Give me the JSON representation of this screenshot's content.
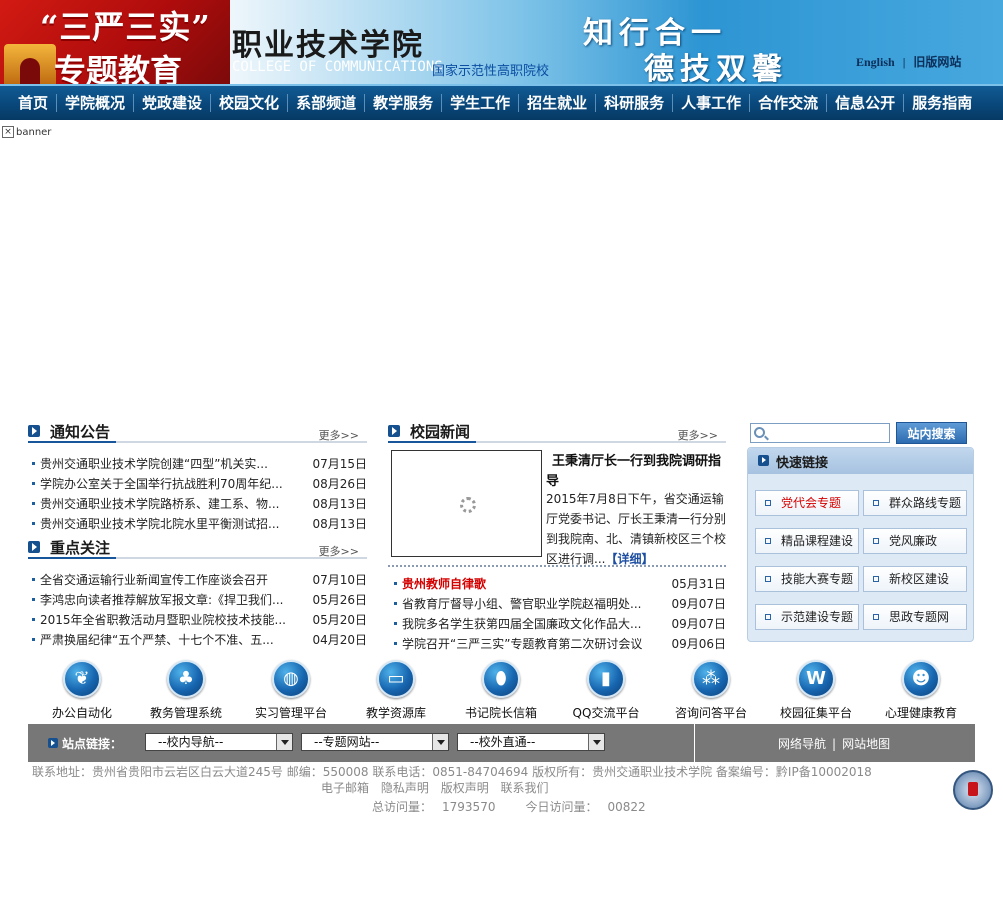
{
  "header": {
    "promo_line1": "“三严三实”",
    "promo_line2": "专题教育",
    "college_cn": "职业技术学院",
    "college_en": "COLLEGE OF COMMUNICATIONS",
    "college_tag": "国家示范性高职院校",
    "motto_line1": "知行合一",
    "motto_line2": "德技双馨",
    "lang_english": "English",
    "lang_sep": "|",
    "lang_old": "旧版网站"
  },
  "nav": {
    "items": [
      "首页",
      "学院概况",
      "党政建设",
      "校园文化",
      "系部频道",
      "教学服务",
      "学生工作",
      "招生就业",
      "科研服务",
      "人事工作",
      "合作交流",
      "信息公开",
      "服务指南"
    ]
  },
  "banner": {
    "alt": "banner"
  },
  "notice": {
    "title": "通知公告",
    "more": "更多>>",
    "items": [
      {
        "title": "贵州交通职业技术学院创建“四型”机关实...",
        "date": "07月15日"
      },
      {
        "title": "学院办公室关于全国举行抗战胜利70周年纪...",
        "date": "08月26日"
      },
      {
        "title": "贵州交通职业技术学院路桥系、建工系、物...",
        "date": "08月13日"
      },
      {
        "title": "贵州交通职业技术学院北院水里平衡测试招...",
        "date": "08月13日"
      }
    ]
  },
  "focus": {
    "title": "重点关注",
    "more": "更多>>",
    "items": [
      {
        "title": "全省交通运输行业新闻宣传工作座谈会召开",
        "date": "07月10日"
      },
      {
        "title": "李鸿忠向读者推荐解放军报文章:《捍卫我们...",
        "date": "05月26日"
      },
      {
        "title": "2015年全省职教活动月暨职业院校技术技能...",
        "date": "05月20日"
      },
      {
        "title": "严肃换届纪律“五个严禁、十七个不准、五...",
        "date": "04月20日"
      }
    ]
  },
  "campus": {
    "title": "校园新闻",
    "more": "更多>>",
    "feature_title": "王秉清厅长一行到我院调研指导",
    "feature_body": "2015年7月8日下午，省交通运输厅党委书记、厅长王秉清一行分别到我院南、北、清镇新校区三个校区进行调...",
    "feature_detail": "【详细】",
    "items": [
      {
        "title": "贵州教师自律歌",
        "date": "05月31日",
        "highlight": true
      },
      {
        "title": "省教育厅督导小组、警官职业学院赵福明处...",
        "date": "09月07日"
      },
      {
        "title": "我院多名学生获第四届全国廉政文化作品大...",
        "date": "09月07日"
      },
      {
        "title": "学院召开“三严三实”专题教育第二次研讨会议",
        "date": "09月06日"
      }
    ]
  },
  "search": {
    "placeholder": "",
    "button": "站内搜索"
  },
  "quick": {
    "title": "快速链接",
    "links": [
      {
        "label": "党代会专题",
        "highlight": true
      },
      {
        "label": "群众路线专题"
      },
      {
        "label": "精品课程建设"
      },
      {
        "label": "党风廉政"
      },
      {
        "label": "技能大赛专题"
      },
      {
        "label": "新校区建设"
      },
      {
        "label": "示范建设专题"
      },
      {
        "label": "思政专题网"
      }
    ]
  },
  "apps": [
    {
      "label": "办公自动化",
      "icon": "leaf-icon"
    },
    {
      "label": "教务管理系统",
      "icon": "tree-icon"
    },
    {
      "label": "实习管理平台",
      "icon": "globe-icon"
    },
    {
      "label": "教学资源库",
      "icon": "monitor-icon"
    },
    {
      "label": "书记院长信箱",
      "icon": "mouse-icon"
    },
    {
      "label": "QQ交流平台",
      "icon": "bar-chart-icon"
    },
    {
      "label": "咨询问答平台",
      "icon": "people-icon"
    },
    {
      "label": "校园征集平台",
      "icon": "w-logo-icon"
    },
    {
      "label": "心理健康教育",
      "icon": "user-group-icon"
    }
  ],
  "links_bar": {
    "label": "站点链接：",
    "select1": "--校内导航--",
    "select2": "--专题网站--",
    "select3": "--校外直通--",
    "right1": "网络导航",
    "sep": "|",
    "right2": "网站地图"
  },
  "footer": {
    "line1": "联系地址：贵州省贵阳市云岩区白云大道245号  邮编：550008 联系电话：0851-84704694  版权所有：贵州交通职业技术学院  备案编号：黔IP备10002018",
    "email": "电子邮箱",
    "privacy": "隐私声明",
    "copyright": "版权声明",
    "contact": "联系我们",
    "total_label": "总访问量：",
    "total_value": "1793570",
    "today_label": "今日访问量：",
    "today_value": "00822"
  },
  "colors": {
    "nav_bg": "#09477a",
    "accent_blue": "#17569a",
    "highlight_red": "#d40000",
    "links_bar_bg": "#777777"
  }
}
